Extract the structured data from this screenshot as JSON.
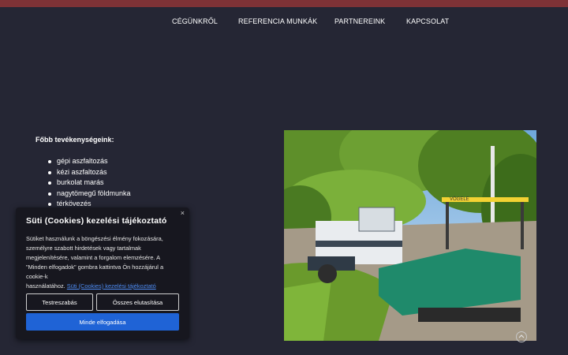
{
  "nav": {
    "items": [
      {
        "label": "CÉGÜNKRŐL"
      },
      {
        "label": "REFERENCIA MUNKÁK"
      },
      {
        "label": "PARTNEREINK"
      },
      {
        "label": "KAPCSOLAT"
      }
    ]
  },
  "activities": {
    "title": "Főbb tevékenységeink:",
    "items": [
      "gépi aszfaltozás",
      "kézi aszfaltozás",
      "burkolat marás",
      "nagytömegű földmunka",
      "térkövezés"
    ]
  },
  "photo": {
    "paver_brand": "VÖGELE"
  },
  "cookie": {
    "close_icon": "×",
    "title": "Süti (Cookies) kezelési tájékoztató",
    "body_line1": "Sütiket használunk a böngészési élmény fokozására,",
    "body_line2": "személyre szabott hirdetések vagy tartalmak",
    "body_line3": "megjelenítésére, valamint a forgalom elemzésére. A",
    "body_line4": "\"Minden elfogadok\" gombra kattintva Ön hozzájárul a",
    "body_line5": "cookie-k",
    "body_line6_prefix": "használatához.",
    "link": "Süti (Cookies) kezelési tájékoztató",
    "btn_customize": "Testreszabás",
    "btn_reject": "Összes elutasítása",
    "btn_accept": "Minde elfogadása"
  },
  "colors": {
    "background": "#252634",
    "topbar": "#7e3236",
    "accept_button": "#1f63d6",
    "link": "#4e8df5"
  }
}
